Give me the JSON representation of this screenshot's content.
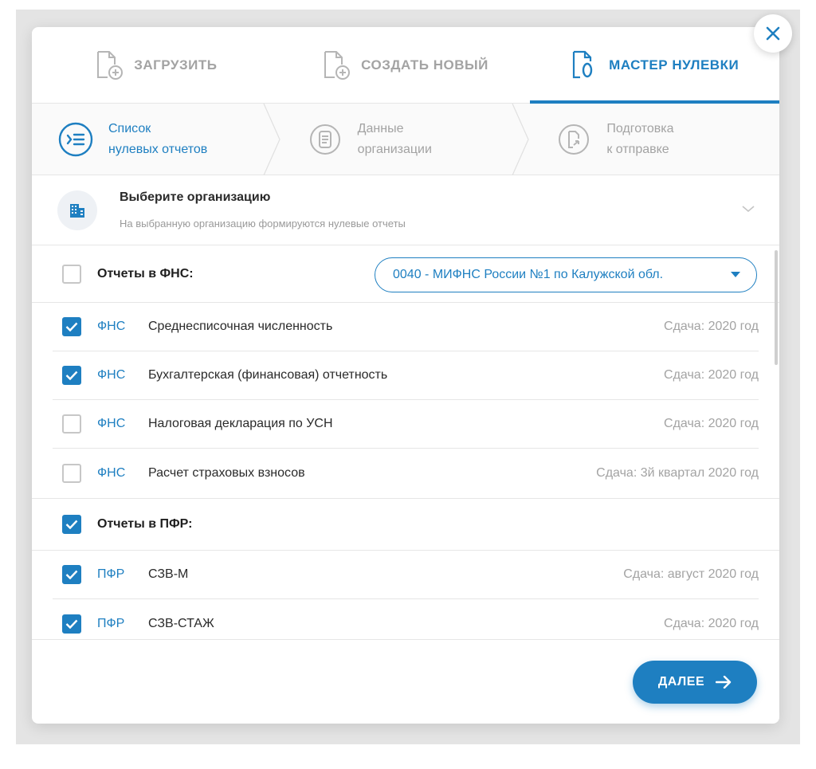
{
  "tabs": [
    {
      "label": "ЗАГРУЗИТЬ",
      "icon": "file-upload-icon",
      "active": false
    },
    {
      "label": "СОЗДАТЬ НОВЫЙ",
      "icon": "file-add-icon",
      "active": false
    },
    {
      "label": "МАСТЕР НУЛЕВКИ",
      "icon": "file-zero-icon",
      "active": true
    }
  ],
  "steps": [
    {
      "label": "Список\nнулевых отчетов",
      "icon": "list-icon",
      "active": true
    },
    {
      "label": "Данные\nорганизации",
      "icon": "document-icon",
      "active": false
    },
    {
      "label": "Подготовка\nк отправке",
      "icon": "send-file-icon",
      "active": false
    }
  ],
  "org": {
    "title": "Выберите организацию",
    "subtitle": "На выбранную организацию формируются нулевые отчеты",
    "icon": "building-icon"
  },
  "groups": [
    {
      "title": "Отчеты в ФНС:",
      "checked": false,
      "inspection": "0040 - МИФНС России №1 по Калужской обл.",
      "items": [
        {
          "agency": "ФНС",
          "name": "Среднесписочная численность",
          "due": "Сдача: 2020 год",
          "checked": true
        },
        {
          "agency": "ФНС",
          "name": "Бухгалтерская (финансовая) отчетность",
          "due": "Сдача: 2020 год",
          "checked": true
        },
        {
          "agency": "ФНС",
          "name": "Налоговая декларация по УСН",
          "due": "Сдача: 2020 год",
          "checked": false
        },
        {
          "agency": "ФНС",
          "name": "Расчет страховых взносов",
          "due": "Сдача: 3й квартал 2020 год",
          "checked": false
        }
      ]
    },
    {
      "title": "Отчеты в ПФР:",
      "checked": true,
      "items": [
        {
          "agency": "ПФР",
          "name": "СЗВ-М",
          "due": "Сдача: август 2020 год",
          "checked": true
        },
        {
          "agency": "ПФР",
          "name": "СЗВ-СТАЖ",
          "due": "Сдача: 2020 год",
          "checked": true
        }
      ]
    }
  ],
  "footer": {
    "next_label": "ДАЛЕЕ"
  },
  "colors": {
    "accent": "#1e7fc1",
    "muted": "#a3a3a3",
    "border": "#e6e6e6"
  }
}
